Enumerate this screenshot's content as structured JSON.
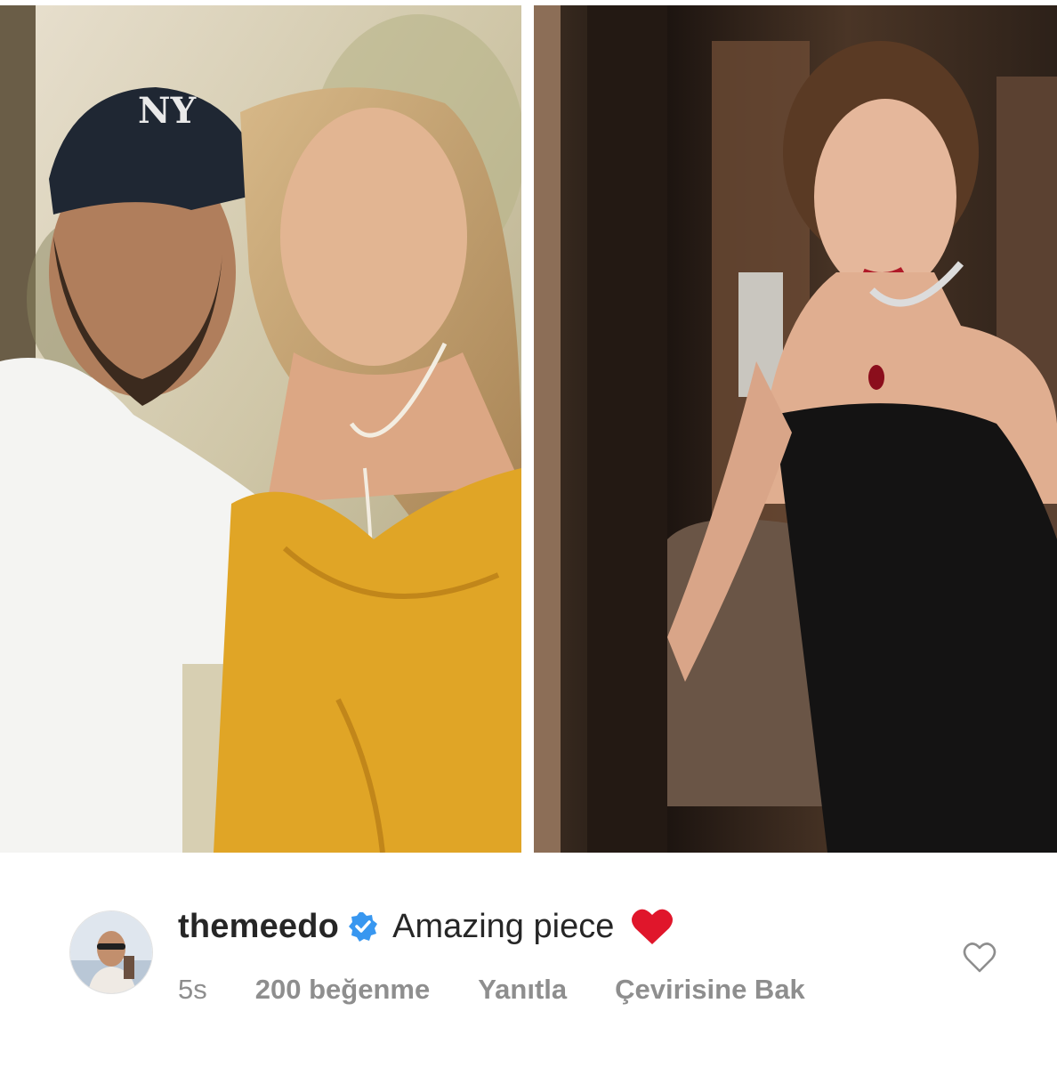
{
  "comment": {
    "username": "themeedo",
    "text": "Amazing piece",
    "meta": {
      "time": "5s",
      "likes": "200 beğenme",
      "reply": "Yanıtla",
      "translate": "Çevirisine Bak"
    }
  },
  "icons": {
    "verified": "verified-badge-icon",
    "emoji": "red-heart-emoji-icon",
    "like": "heart-outline-icon"
  },
  "colors": {
    "verified_blue": "#3897f0",
    "heart_red": "#e0162b",
    "text_primary": "#262626",
    "text_secondary": "#8e8e8e"
  }
}
